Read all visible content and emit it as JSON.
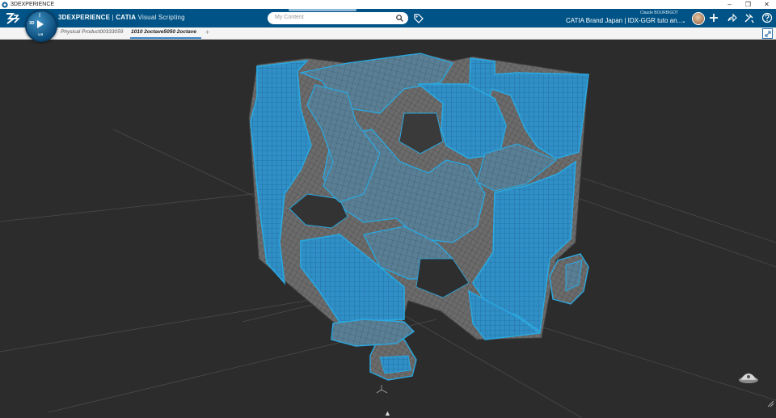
{
  "window": {
    "title": "3DEXPERIENCE",
    "controls": [
      "minimize",
      "restore",
      "close"
    ]
  },
  "topbar": {
    "brand_bold": "3DEXPERIENCE",
    "brand_sep": " | ",
    "brand_product": "CATIA",
    "brand_app": " Visual Scripting",
    "compass_version": "V.R",
    "compass_3d": "3D",
    "search_placeholder": "My Content",
    "username": "Claude BOURBIGOT",
    "context_label": "CATIA Brand Japan | IDX-GGR tuto an...",
    "accent_color": "#005386"
  },
  "tabs": [
    {
      "label": "Physical Product00333059",
      "active": false
    },
    {
      "label": "1010 2octave5050 2octave",
      "active": true
    }
  ],
  "tab_add_label": "+",
  "viewport": {
    "background": "#2c2c2c",
    "highlight_color": "#29a8e0",
    "mesh_color": "#6e6e6e"
  }
}
